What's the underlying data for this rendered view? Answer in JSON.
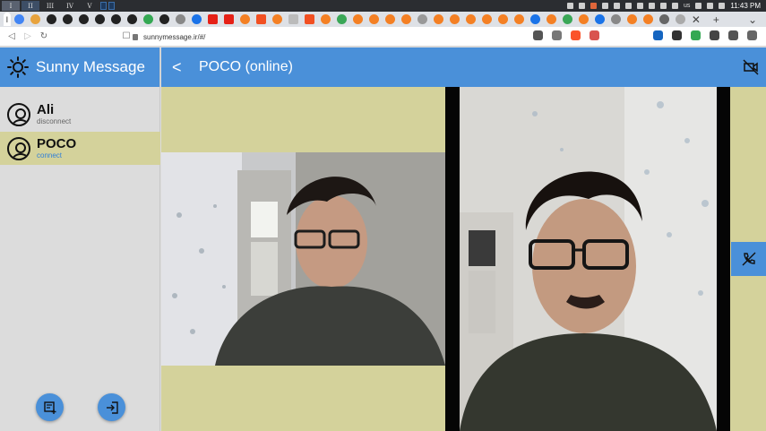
{
  "system": {
    "workspaces": [
      "I",
      "II",
      "III",
      "IV",
      "V"
    ],
    "keyboard": "us",
    "clock": "11:43 PM"
  },
  "browser": {
    "url": "sunnymessage.ir/#/",
    "active_tab_label": "I"
  },
  "app": {
    "brand": "Sunny Message",
    "accent_color": "#4a90d9",
    "highlight_color": "#d4d29b",
    "contacts": [
      {
        "name": "Ali",
        "status": "disconnect"
      },
      {
        "name": "POCO",
        "status": "connect",
        "selected": true
      }
    ],
    "chat_header": {
      "back": "<",
      "title": "POCO (online)"
    },
    "fabs": {
      "new_chat_icon": "add-note-icon",
      "login_icon": "login-icon"
    },
    "call": {
      "hangup_icon": "phone-disabled-icon",
      "camera_off_icon": "videocam-off-icon"
    }
  }
}
